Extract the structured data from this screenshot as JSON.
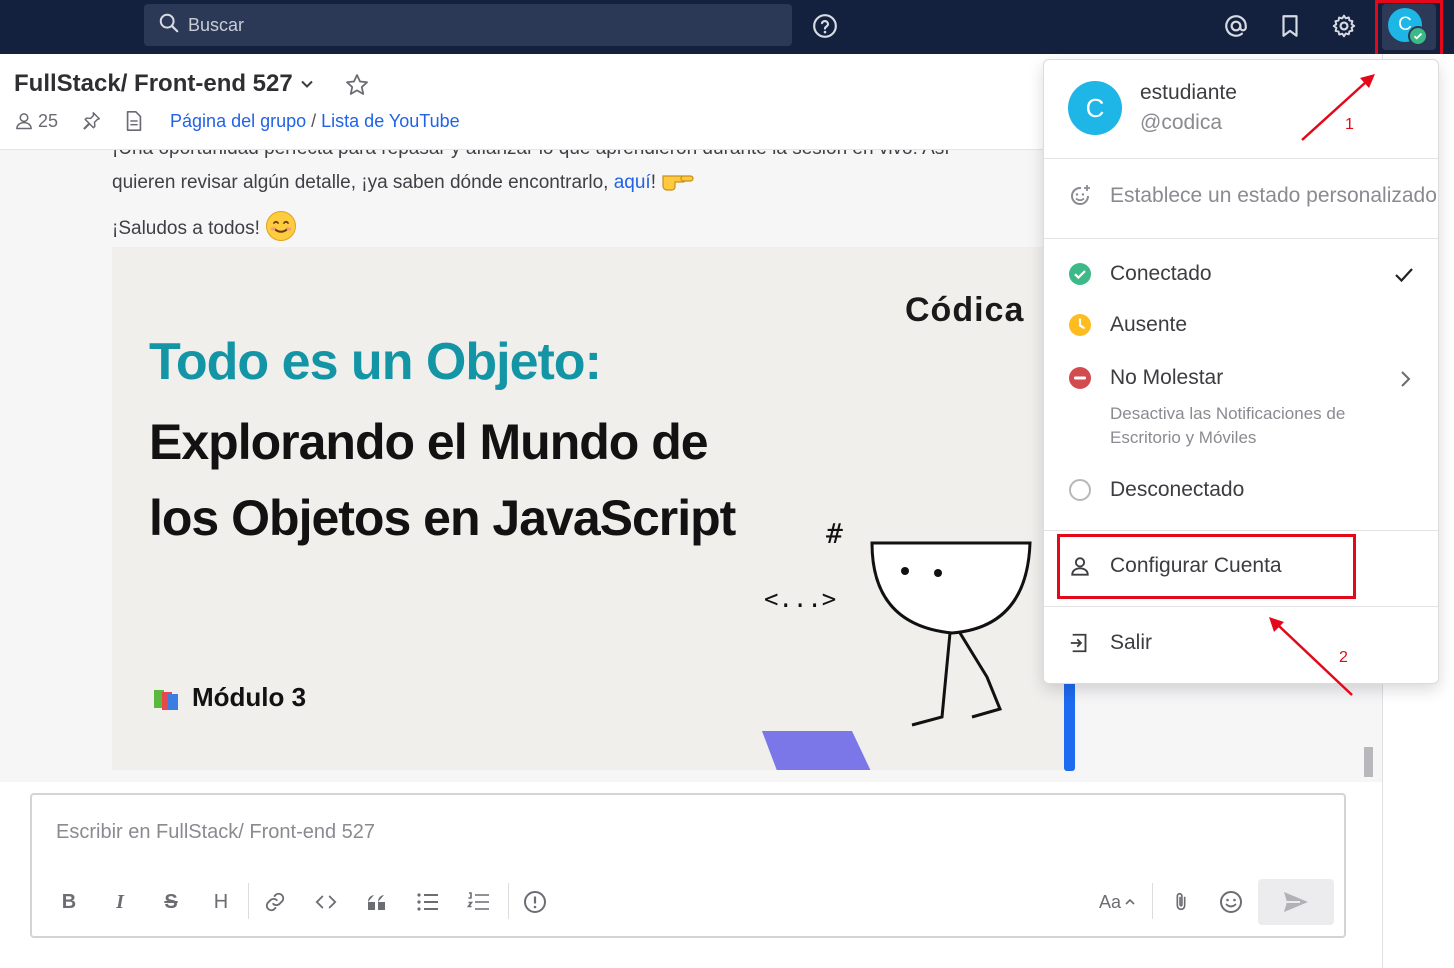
{
  "topbar": {
    "search_placeholder": "Buscar",
    "icons": [
      "search-icon",
      "help-icon",
      "mention-icon",
      "bookmark-icon",
      "gear-icon"
    ],
    "avatar_letter": "C"
  },
  "channel": {
    "title": "FullStack/ Front-end 527",
    "member_count": "25",
    "link_group": "Página del grupo",
    "separator": "/",
    "link_youtube": "Lista de YouTube"
  },
  "message": {
    "line_cut": "¡Una oportunidad perfecta para repasar y afianzar lo que aprendieron durante la sesión en vivo! Así",
    "line2_prefix": "quieren revisar algún detalle, ¡ya saben dónde encontrarlo,",
    "line2_link": "aquí",
    "line2_suffix": "!",
    "greeting": "¡Saludos a todos!"
  },
  "banner": {
    "logo": "Códica",
    "title_accent": "Todo es un Objeto:",
    "title_line2": "Explorando el Mundo de",
    "title_line3": "los Objetos en JavaScript",
    "hash": "#",
    "code_glyph": "<...>",
    "module": "Módulo 3"
  },
  "composer": {
    "placeholder": "Escribir en FullStack/ Front-end 527",
    "format_bold": "B",
    "format_italic": "I",
    "format_strike": "S",
    "format_heading": "H",
    "text_size": "Aa"
  },
  "dropdown": {
    "avatar_letter": "C",
    "name": "estudiante",
    "handle": "@codica",
    "custom_status": "Establece un estado personalizado",
    "status_online": "Conectado",
    "status_away": "Ausente",
    "status_dnd": "No Molestar",
    "status_dnd_desc_1": "Desactiva las Notificaciones de",
    "status_dnd_desc_2": "Escritorio y Móviles",
    "status_offline": "Desconectado",
    "account_settings": "Configurar Cuenta",
    "logout": "Salir"
  },
  "annotations": {
    "one": "1",
    "two": "2"
  },
  "colors": {
    "topbar": "#14213e",
    "accent_link": "#2162e7",
    "avatar": "#1eb6e7",
    "online": "#3db887",
    "away": "#ffbc1f",
    "dnd": "#d24b4e",
    "annotation_red": "#e3081a",
    "banner_accent": "#1495a6"
  }
}
